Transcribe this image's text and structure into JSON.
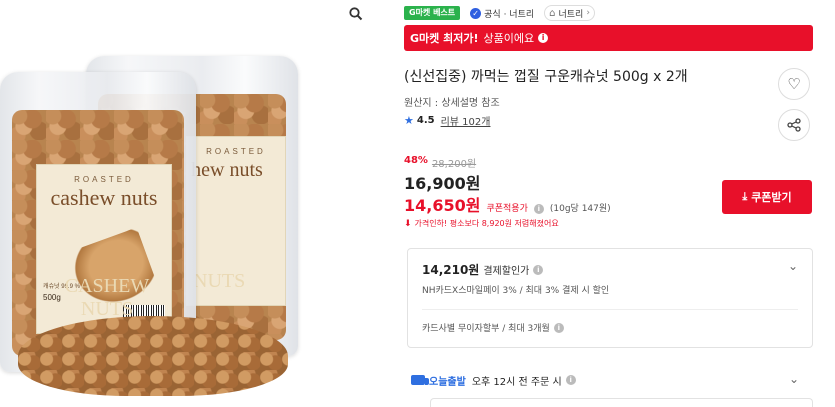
{
  "gallery": {
    "zoom_icon": "magnifier-icon",
    "bag_label_sub": "ROASTED",
    "bag_label_main": "cashew nuts",
    "bag_label_back": "hew nuts",
    "bag_label_rate": "캐슈넛 99.9 %",
    "bag_label_weight": "500g",
    "bag_label_outline": "CASHEW NUTS",
    "bag_label_outline_back": "NUTS"
  },
  "badges": {
    "best_label": "G마켓 베스트",
    "official_label": "공식 · 너트리",
    "store_label": "너트리",
    "check_symbol": "✓",
    "store_symbol": "⌂",
    "chevron_symbol": "›"
  },
  "lowest_bar": {
    "strong": "G마켓 최저가!",
    "rest": "상품이에요",
    "info_symbol": "i"
  },
  "product": {
    "title": "(신선집중) 까먹는 껍질 구운캐슈넛 500g x 2개",
    "origin": "원산지 : 상세설명 참조",
    "rating_star": "★",
    "rating": "4.5",
    "reviews": "리뷰 102개"
  },
  "actions": {
    "heart_symbol": "♡",
    "share_symbol": "⋖"
  },
  "pricing": {
    "discount_rate": "48%",
    "original_price": "28,200원",
    "price": "16,900원",
    "coupon_price": "14,650원",
    "coupon_applied": "쿠폰적용가",
    "info_symbol": "i",
    "unit_price": "(10g당 147원)",
    "hint_symbol": "⬇",
    "hint": "가격인하! 평소보다 8,920원 저렴해졌어요",
    "coupon_button": "쿠폰받기",
    "coupon_button_symbol": "⤓"
  },
  "discount_box": {
    "price": "14,210원",
    "label": "결제할인가",
    "line1": "NH카드X스마일페이 3% / 최대 3% 결제 시 할인",
    "line2": "카드사별 무이자할부 / 최대 3개월",
    "chevron_symbol": "⌄"
  },
  "delivery": {
    "label": "오늘출발",
    "text": "오후 12시 전 주문 시",
    "chevron_symbol": "⌄"
  },
  "colors": {
    "accent_red": "#e8102a",
    "best_green": "#2bb24c",
    "link_blue": "#2f6fe0"
  }
}
